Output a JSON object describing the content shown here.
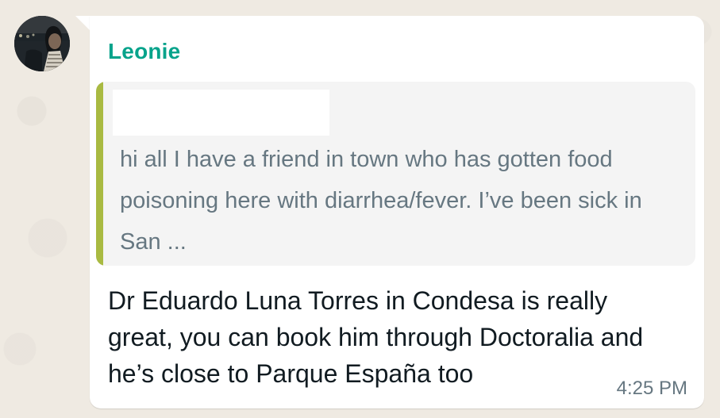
{
  "chat": {
    "avatar_icon": "profile-photo",
    "sender_name": "Leonie",
    "quoted_message": {
      "author_hidden": "",
      "text": "hi all I have a friend in town who has gotten food poisoning here with diarrhea/fever. I’ve been sick in San ...",
      "accent_color": "#a9ba42"
    },
    "message_text": "Dr Eduardo Luna Torres in Condesa is really great, you can book him through Doctoralia and he’s close to Parque España too",
    "timestamp": "4:25 PM",
    "sender_color": "#06a38b"
  }
}
